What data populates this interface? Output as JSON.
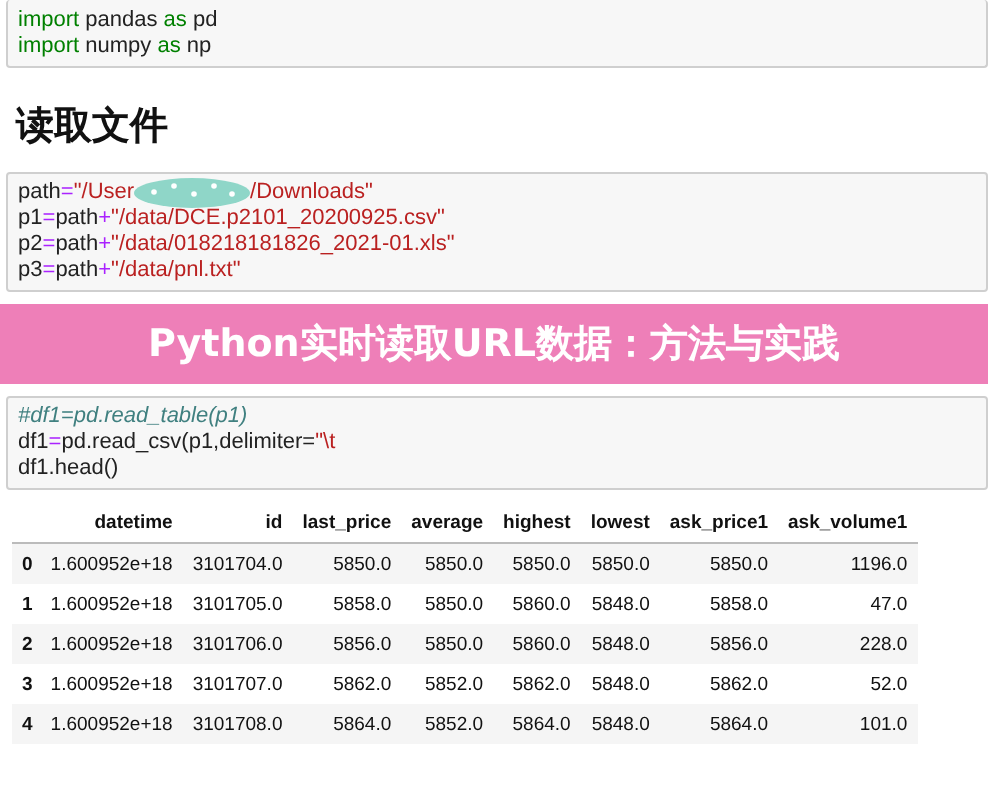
{
  "cells": [
    {
      "kind": "code",
      "lines": [
        [
          {
            "kind": "kw",
            "s": "import"
          },
          {
            "kind": "name",
            "s": " pandas "
          },
          {
            "kind": "kw",
            "s": "as"
          },
          {
            "kind": "name",
            "s": " pd"
          }
        ],
        [
          {
            "kind": "kw",
            "s": "import"
          },
          {
            "kind": "name",
            "s": " numpy "
          },
          {
            "kind": "kw",
            "s": "as"
          },
          {
            "kind": "name",
            "s": " np"
          }
        ]
      ]
    },
    {
      "kind": "heading",
      "text": "读取文件"
    },
    {
      "kind": "code",
      "lines": [
        [
          {
            "kind": "name",
            "s": "path"
          },
          {
            "kind": "op",
            "s": "="
          },
          {
            "kind": "str",
            "s": "\"/User"
          },
          {
            "kind": "redacted"
          },
          {
            "kind": "str",
            "s": "/Downloads\""
          }
        ],
        [
          {
            "kind": "name",
            "s": "p1"
          },
          {
            "kind": "op",
            "s": "="
          },
          {
            "kind": "name",
            "s": "path"
          },
          {
            "kind": "op",
            "s": "+"
          },
          {
            "kind": "str",
            "s": "\"/data/DCE.p2101_20200925.csv\""
          }
        ],
        [
          {
            "kind": "name",
            "s": "p2"
          },
          {
            "kind": "op",
            "s": "="
          },
          {
            "kind": "name",
            "s": "path"
          },
          {
            "kind": "op",
            "s": "+"
          },
          {
            "kind": "str",
            "s": "\"/data/018218181826_2021-01.xls\""
          }
        ],
        [
          {
            "kind": "name",
            "s": "p3"
          },
          {
            "kind": "op",
            "s": "="
          },
          {
            "kind": "name",
            "s": "path"
          },
          {
            "kind": "op",
            "s": "+"
          },
          {
            "kind": "str",
            "s": "\"/data/pnl.txt\""
          }
        ]
      ]
    },
    {
      "kind": "banner",
      "text": "Python实时读取URL数据：方法与实践"
    },
    {
      "kind": "code",
      "lines": [
        [
          {
            "kind": "comment",
            "s": "#df1=pd.read_table(p1)"
          }
        ],
        [
          {
            "kind": "name",
            "s": "df1"
          },
          {
            "kind": "op",
            "s": "="
          },
          {
            "kind": "name",
            "s": "pd.read_csv(p1,delimiter="
          },
          {
            "kind": "str",
            "s": "\"\\t"
          }
        ],
        [
          {
            "kind": "name",
            "s": "df1.head()"
          }
        ]
      ]
    }
  ],
  "table": {
    "columns": [
      "",
      "datetime",
      "id",
      "last_price",
      "average",
      "highest",
      "lowest",
      "ask_price1",
      "ask_volume1"
    ],
    "rows": [
      [
        "0",
        "1.600952e+18",
        "3101704.0",
        "5850.0",
        "5850.0",
        "5850.0",
        "5850.0",
        "5850.0",
        "1196.0"
      ],
      [
        "1",
        "1.600952e+18",
        "3101705.0",
        "5858.0",
        "5850.0",
        "5860.0",
        "5848.0",
        "5858.0",
        "47.0"
      ],
      [
        "2",
        "1.600952e+18",
        "3101706.0",
        "5856.0",
        "5850.0",
        "5860.0",
        "5848.0",
        "5856.0",
        "228.0"
      ],
      [
        "3",
        "1.600952e+18",
        "3101707.0",
        "5862.0",
        "5852.0",
        "5862.0",
        "5848.0",
        "5862.0",
        "52.0"
      ],
      [
        "4",
        "1.600952e+18",
        "3101708.0",
        "5864.0",
        "5852.0",
        "5864.0",
        "5848.0",
        "5864.0",
        "101.0"
      ]
    ]
  }
}
